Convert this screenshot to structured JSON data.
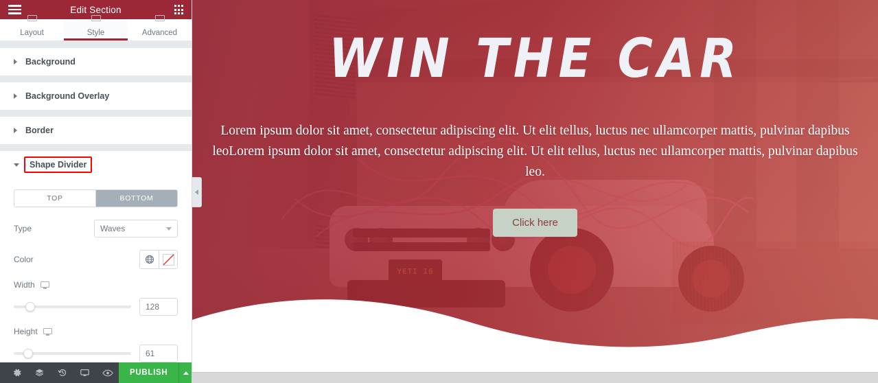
{
  "panel": {
    "header": {
      "title": "Edit Section",
      "menu_icon": "hamburger-icon",
      "widgets_icon": "widgets-grid-icon"
    },
    "tabs": [
      {
        "label": "Layout",
        "active": false
      },
      {
        "label": "Style",
        "active": true
      },
      {
        "label": "Advanced",
        "active": false
      }
    ],
    "sections": [
      {
        "label": "Background",
        "open": false
      },
      {
        "label": "Background Overlay",
        "open": false
      },
      {
        "label": "Border",
        "open": false
      },
      {
        "label": "Shape Divider",
        "open": true,
        "highlighted": true
      }
    ],
    "shape_divider": {
      "position_tabs": {
        "top_label": "TOP",
        "bottom_label": "BOTTOM",
        "selected": "BOTTOM"
      },
      "type": {
        "label": "Type",
        "value": "Waves"
      },
      "color": {
        "label": "Color",
        "global_icon": "globe-icon",
        "swatch_icon": "no-color-swatch-icon",
        "swatch_value": "transparent",
        "swatch_stroke": "#e03030"
      },
      "width": {
        "label": "Width",
        "device_icon": "desktop-icon",
        "value": "128",
        "slider_percent": 14
      },
      "height": {
        "label": "Height",
        "device_icon": "desktop-icon",
        "value": "61",
        "slider_percent": 12
      }
    },
    "footer": {
      "icons": [
        {
          "name": "settings-gear-icon",
          "glyph": "gear"
        },
        {
          "name": "navigator-layers-icon",
          "glyph": "layers"
        },
        {
          "name": "history-revisions-icon",
          "glyph": "history"
        },
        {
          "name": "responsive-mode-icon",
          "glyph": "monitor"
        },
        {
          "name": "preview-changes-icon",
          "glyph": "eye"
        }
      ],
      "publish_label": "PUBLISH",
      "publish_color": "#39b54a",
      "publish_arrow_icon": "chevron-up-icon"
    }
  },
  "canvas": {
    "section_outline_color": "#59c3f0",
    "collapse_handle_icon": "chevron-left-icon",
    "hero": {
      "heading": "WIN THE CAR",
      "paragraph": "Lorem ipsum dolor sit amet, consectetur adipiscing elit. Ut elit tellus, luctus nec ullamcorper mattis, pulvinar dapibus leoLorem ipsum dolor sit amet, consectetur adipiscing elit. Ut elit tellus, luctus nec ullamcorper mattis, pulvinar dapibus leo.",
      "cta_label": "Click here",
      "cta_bg": "#c6d2c5",
      "cta_text_color": "#8d3b3b",
      "overlay_color": "#9b2737",
      "divider_color": "#ffffff",
      "license_plate": "YETI 16"
    }
  }
}
